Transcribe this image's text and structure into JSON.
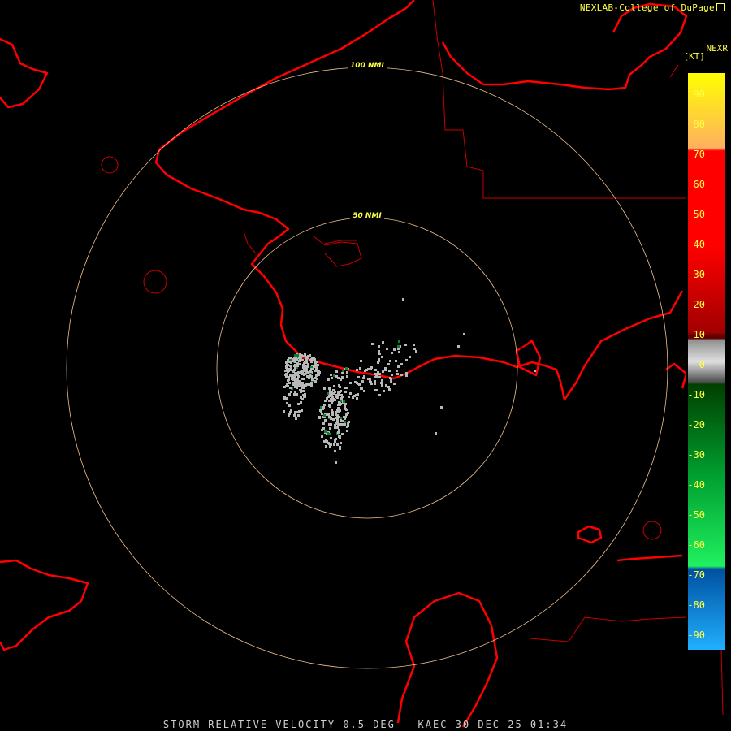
{
  "header": {
    "credit": "NEXLAB-College of DuPage",
    "product": "NEXR",
    "unit": "[KT]"
  },
  "caption": "STORM RELATIVE VELOCITY 0.5 DEG - KAEC 30 DEC 25 01:34",
  "range_rings": [
    {
      "label": "100 NMI"
    },
    {
      "label": "50 NMI"
    }
  ],
  "color_scale": {
    "labels": [
      "90",
      "80",
      "70",
      "60",
      "50",
      "40",
      "30",
      "20",
      "10",
      "0",
      "-10",
      "-20",
      "-30",
      "-40",
      "-50",
      "-60",
      "-70",
      "-80",
      "-90"
    ],
    "colors": {
      "top": "#ffff00",
      "orange": "#ffa040",
      "red": "#ff0000",
      "darkred": "#5a0000",
      "gray": "#a0a0a0",
      "darkgreen": "#005000",
      "green": "#00d040",
      "blue": "#1060e0",
      "lightblue": "#20a8ff"
    }
  },
  "map_colors": {
    "coastline": "#ff0000",
    "border": "#c80000",
    "rings": "#f0c090",
    "echo": "#b8b8b8"
  }
}
